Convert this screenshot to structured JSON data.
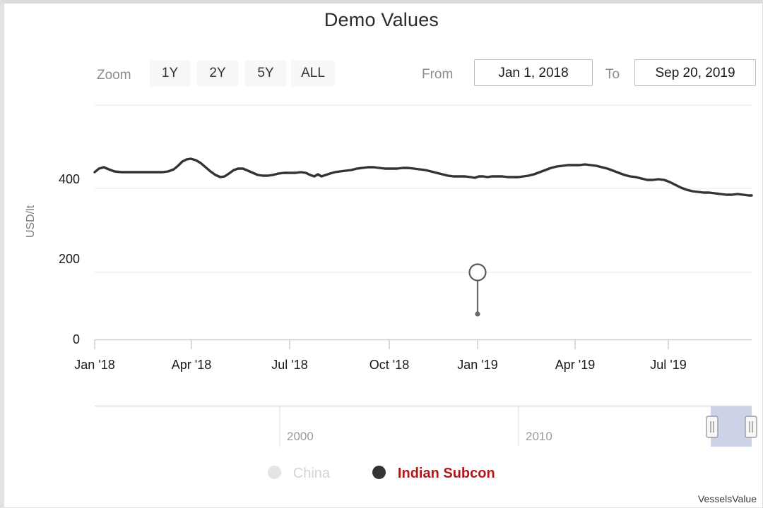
{
  "chart": {
    "title": "Demo Values",
    "credits": "VesselsValue"
  },
  "toolbar": {
    "zoom_label": "Zoom",
    "range_buttons": [
      {
        "label": "1Y"
      },
      {
        "label": "2Y"
      },
      {
        "label": "5Y"
      },
      {
        "label": "ALL"
      }
    ],
    "from_label": "From",
    "from_value": "Jan 1, 2018",
    "to_label": "To",
    "to_value": "Sep 20, 2019"
  },
  "legend": [
    {
      "label": "China",
      "color": "#e4e4e4",
      "active": false
    },
    {
      "label": "Indian Subcon",
      "color": "#333333",
      "active": true
    }
  ],
  "navigator": {
    "ticks": [
      "2000",
      "2010"
    ],
    "selection_fill": "#ccd3e8"
  },
  "chart_data": {
    "type": "line",
    "title": "Demo Values",
    "xlabel": "",
    "ylabel": "USD/lt",
    "ylim": [
      0,
      500
    ],
    "yticks": [
      0,
      200,
      400
    ],
    "xticks": [
      "Jan '18",
      "Apr '18",
      "Jul '18",
      "Oct '18",
      "Jan '19",
      "Apr '19",
      "Jul '19"
    ],
    "grid": true,
    "legend_position": "bottom",
    "series": [
      {
        "name": "Indian Subcon",
        "color": "#333333",
        "visible": true,
        "x": [
          "2018-01-01",
          "2018-01-15",
          "2018-02-01",
          "2018-02-15",
          "2018-03-01",
          "2018-03-15",
          "2018-04-01",
          "2018-04-10",
          "2018-04-20",
          "2018-05-01",
          "2018-05-15",
          "2018-06-01",
          "2018-06-10",
          "2018-06-20",
          "2018-07-01",
          "2018-07-15",
          "2018-08-01",
          "2018-08-15",
          "2018-09-01",
          "2018-09-15",
          "2018-10-01",
          "2018-10-15",
          "2018-11-01",
          "2018-11-15",
          "2018-12-01",
          "2018-12-15",
          "2019-01-01",
          "2019-01-15",
          "2019-02-01",
          "2019-02-15",
          "2019-03-01",
          "2019-03-15",
          "2019-04-01",
          "2019-04-15",
          "2019-05-01",
          "2019-05-15",
          "2019-06-01",
          "2019-06-15",
          "2019-07-01",
          "2019-07-15",
          "2019-08-01",
          "2019-08-15",
          "2019-09-01",
          "2019-09-20"
        ],
        "y": [
          425,
          419,
          424,
          425,
          425,
          426,
          430,
          448,
          445,
          437,
          424,
          428,
          430,
          423,
          421,
          422,
          420,
          419,
          418,
          416,
          419,
          417,
          422,
          427,
          427,
          429,
          430,
          427,
          422,
          419,
          416,
          416,
          418,
          414,
          417,
          419,
          424,
          431,
          434,
          433,
          430,
          424,
          417,
          414
        ],
        "y_full": [
          425,
          419,
          424,
          425,
          425,
          426,
          430,
          448,
          445,
          437,
          424,
          428,
          430,
          423,
          421,
          422,
          420,
          419,
          418,
          416,
          419,
          417,
          422,
          427,
          427,
          429,
          430,
          427,
          422,
          419,
          416,
          416,
          418,
          414,
          417,
          419,
          424,
          431,
          434,
          433,
          430,
          424,
          417,
          414
        ]
      },
      {
        "name": "China",
        "color": "#e4e4e4",
        "visible": false,
        "x": [],
        "y": []
      }
    ],
    "annotations": [
      {
        "type": "flag-marker",
        "x": "2019-01-01",
        "value": 170,
        "anchor_value": 62
      }
    ]
  }
}
